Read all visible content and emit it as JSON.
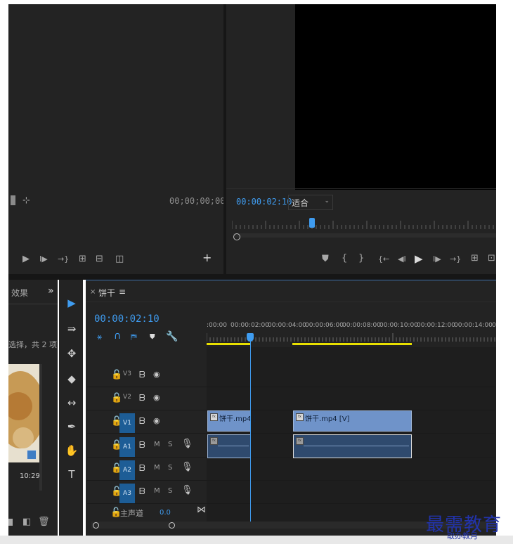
{
  "source_monitor": {
    "timecode": "00;00;00;00"
  },
  "program_monitor": {
    "timecode": "00:00:02:10",
    "fit_select": {
      "selected": "适合",
      "options": [
        "适合"
      ]
    },
    "playhead_progress": 0.24
  },
  "effects_panel": {
    "tab_label": "效果",
    "overflow_glyph": "»",
    "selection_text": "选择，共 2 项",
    "thumb_duration": "10:29"
  },
  "tools": [
    {
      "name": "selection-tool-icon",
      "glyph": "▶"
    },
    {
      "name": "track-select-forward-icon",
      "glyph": "⇛"
    },
    {
      "name": "ripple-edit-icon",
      "glyph": "✥"
    },
    {
      "name": "razor-tool-icon",
      "glyph": "◆"
    },
    {
      "name": "slip-tool-icon",
      "glyph": "↔"
    },
    {
      "name": "pen-tool-icon",
      "glyph": "✒"
    },
    {
      "name": "hand-tool-icon",
      "glyph": "✋"
    },
    {
      "name": "type-tool-icon",
      "glyph": "T"
    }
  ],
  "timeline": {
    "close_glyph": "×",
    "sequence_name": "饼干",
    "menu_glyph": "≡",
    "timecode": "00:00:02:10",
    "ruler_labels": [
      ":00:00",
      "00:00:02:00",
      "00:00:04:00",
      "00:00:06:00",
      "00:00:08:00",
      "00:00:10:00",
      "00:00:12:00",
      "00:00:14:00",
      "0"
    ],
    "tracks": [
      {
        "id": "V3",
        "type": "video",
        "active": false
      },
      {
        "id": "V2",
        "type": "video",
        "active": false
      },
      {
        "id": "V1",
        "type": "video",
        "active": true
      },
      {
        "id": "A1",
        "type": "audio",
        "active": true
      },
      {
        "id": "A2",
        "type": "audio",
        "active": true
      },
      {
        "id": "A3",
        "type": "audio",
        "active": true
      }
    ],
    "mute_label": "M",
    "solo_label": "S",
    "master_label": "主声道",
    "master_value": "0.0",
    "clips": {
      "v1_clip1": "饼干.mp4 [",
      "v1_clip2": "饼干.mp4 [V]"
    }
  },
  "watermark": {
    "text": "最需教育",
    "subtext": "取办教月"
  },
  "colors": {
    "panel_bg": "#232323",
    "accent_blue": "#3f9cf0",
    "work_area_yellow": "#e8e000",
    "clip_video": "#6f93c9",
    "clip_audio": "#2f4a6e"
  }
}
